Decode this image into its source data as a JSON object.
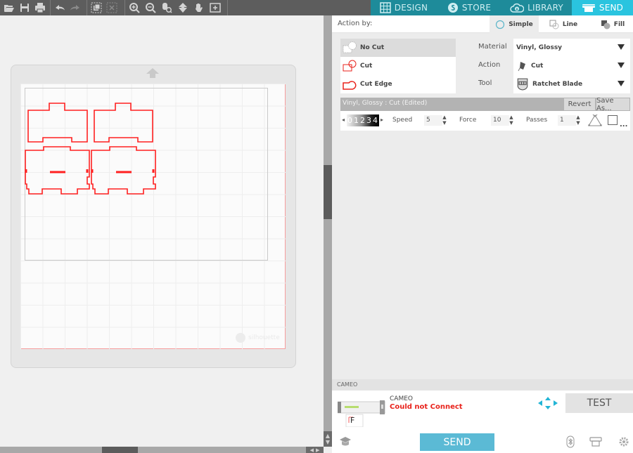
{
  "toolbar": {
    "groups": [
      [
        "open-icon",
        "save-icon",
        "print-icon"
      ],
      [
        "undo-icon",
        "redo-icon"
      ],
      [
        "select-all-icon",
        "deselect-icon"
      ],
      [
        "zoom-in-icon",
        "zoom-out-icon",
        "zoom-fit-icon",
        "pan-down-icon",
        "hand-icon",
        "fit-page-icon"
      ]
    ]
  },
  "nav": {
    "tabs": [
      {
        "label": "DESIGN",
        "icon": "grid-icon",
        "active": false
      },
      {
        "label": "STORE",
        "icon": "store-icon",
        "active": false
      },
      {
        "label": "LIBRARY",
        "icon": "cloud-icon",
        "active": false
      },
      {
        "label": "SEND",
        "icon": "cutter-icon",
        "active": true
      }
    ],
    "accent": "#1e8b9a",
    "active_color": "#2ac4df"
  },
  "canvas": {
    "watermark": "silhouette",
    "cut_line_color": "#ff2020"
  },
  "panel": {
    "action_by_label": "Action by:",
    "modes": [
      {
        "label": "Simple",
        "active": true
      },
      {
        "label": "Line",
        "active": false
      },
      {
        "label": "Fill",
        "active": false
      }
    ],
    "cut_options": [
      {
        "label": "No Cut",
        "selected": true
      },
      {
        "label": "Cut",
        "selected": false
      },
      {
        "label": "Cut Edge",
        "selected": false
      }
    ],
    "properties": {
      "material_label": "Material",
      "material_value": "Vinyl, Glossy",
      "action_label": "Action",
      "action_value": "Cut",
      "tool_label": "Tool",
      "tool_value": "Ratchet Blade"
    },
    "preset": {
      "name": "Vinyl, Glossy : Cut (Edited)",
      "revert_label": "Revert",
      "save_as_label": "Save As..."
    },
    "settings": {
      "blade_depth": "01234",
      "speed_label": "Speed",
      "speed_value": "5",
      "force_label": "Force",
      "force_value": "10",
      "passes_label": "Passes",
      "passes_value": "1",
      "more_label": "..."
    },
    "device": {
      "header": "CAMEO",
      "name": "CAMEO",
      "status": "Could not Connect",
      "status_color": "#e8221b",
      "preview_letter": "F",
      "test_label": "TEST",
      "send_label": "SEND"
    }
  }
}
